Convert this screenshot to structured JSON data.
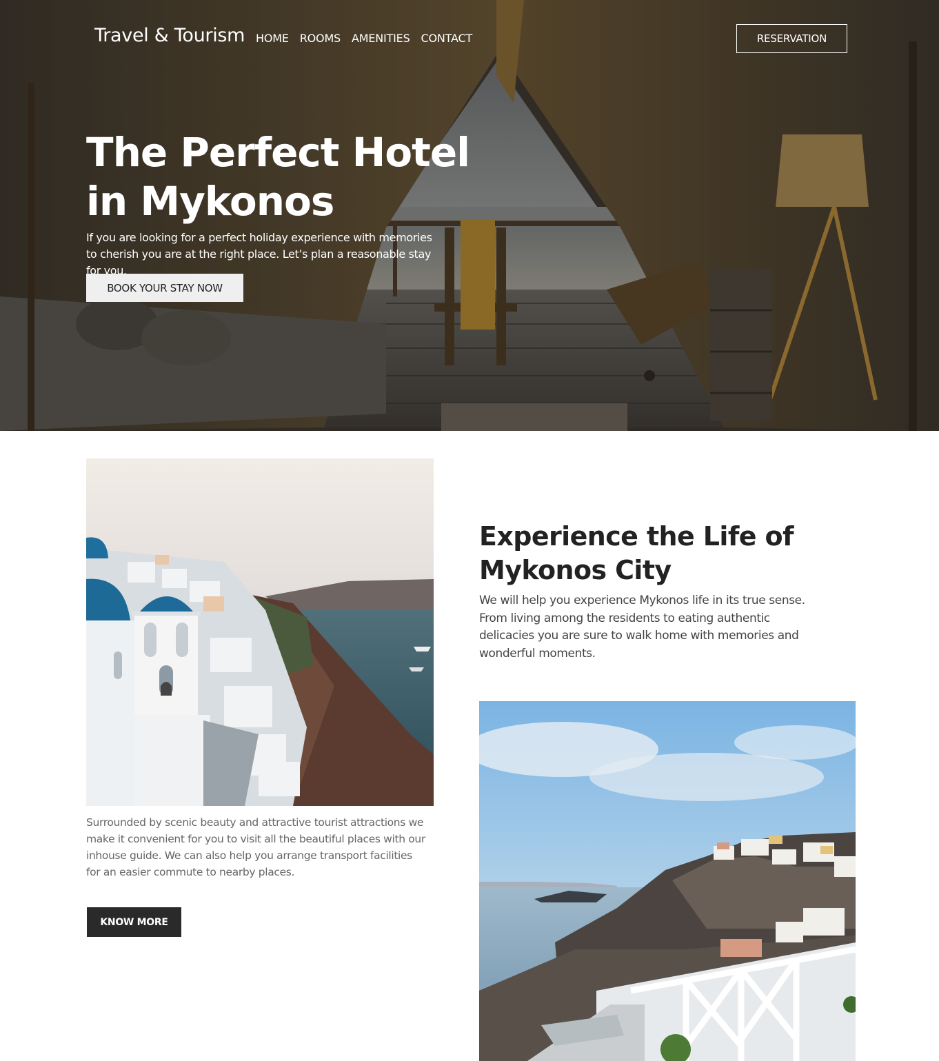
{
  "nav": {
    "brand": "Travel & Tourism",
    "menu": [
      "HOME",
      "ROOMS",
      "AMENITIES",
      "CONTACT"
    ],
    "reservation_label": "RESERVATION"
  },
  "hero": {
    "title": "The Perfect Hotel in Mykonos",
    "subtitle": "If you are looking for a perfect holiday experience with memories to cherish you are at the right place. Let’s plan a reasonable stay for you.",
    "cta_label": "BOOK YOUR STAY NOW"
  },
  "experience": {
    "title": "Experience the Life of Mykonos City",
    "text": "We will help you experience Mykonos life in its true sense. From living among the residents to eating authentic delicacies you are sure to walk home with memories and wonderful moments."
  },
  "attractions": {
    "text": "Surrounded by scenic beauty and attractive tourist attractions we make it convenient for you to visit all the beautiful places with our inhouse guide. We can also help you arrange transport facilities for an easier commute to nearby places.",
    "cta_label": "KNOW MORE"
  },
  "colors": {
    "dark_button": "#2a2a2a",
    "light_button": "#efefef",
    "hero_overlay": "#2e2b26"
  }
}
